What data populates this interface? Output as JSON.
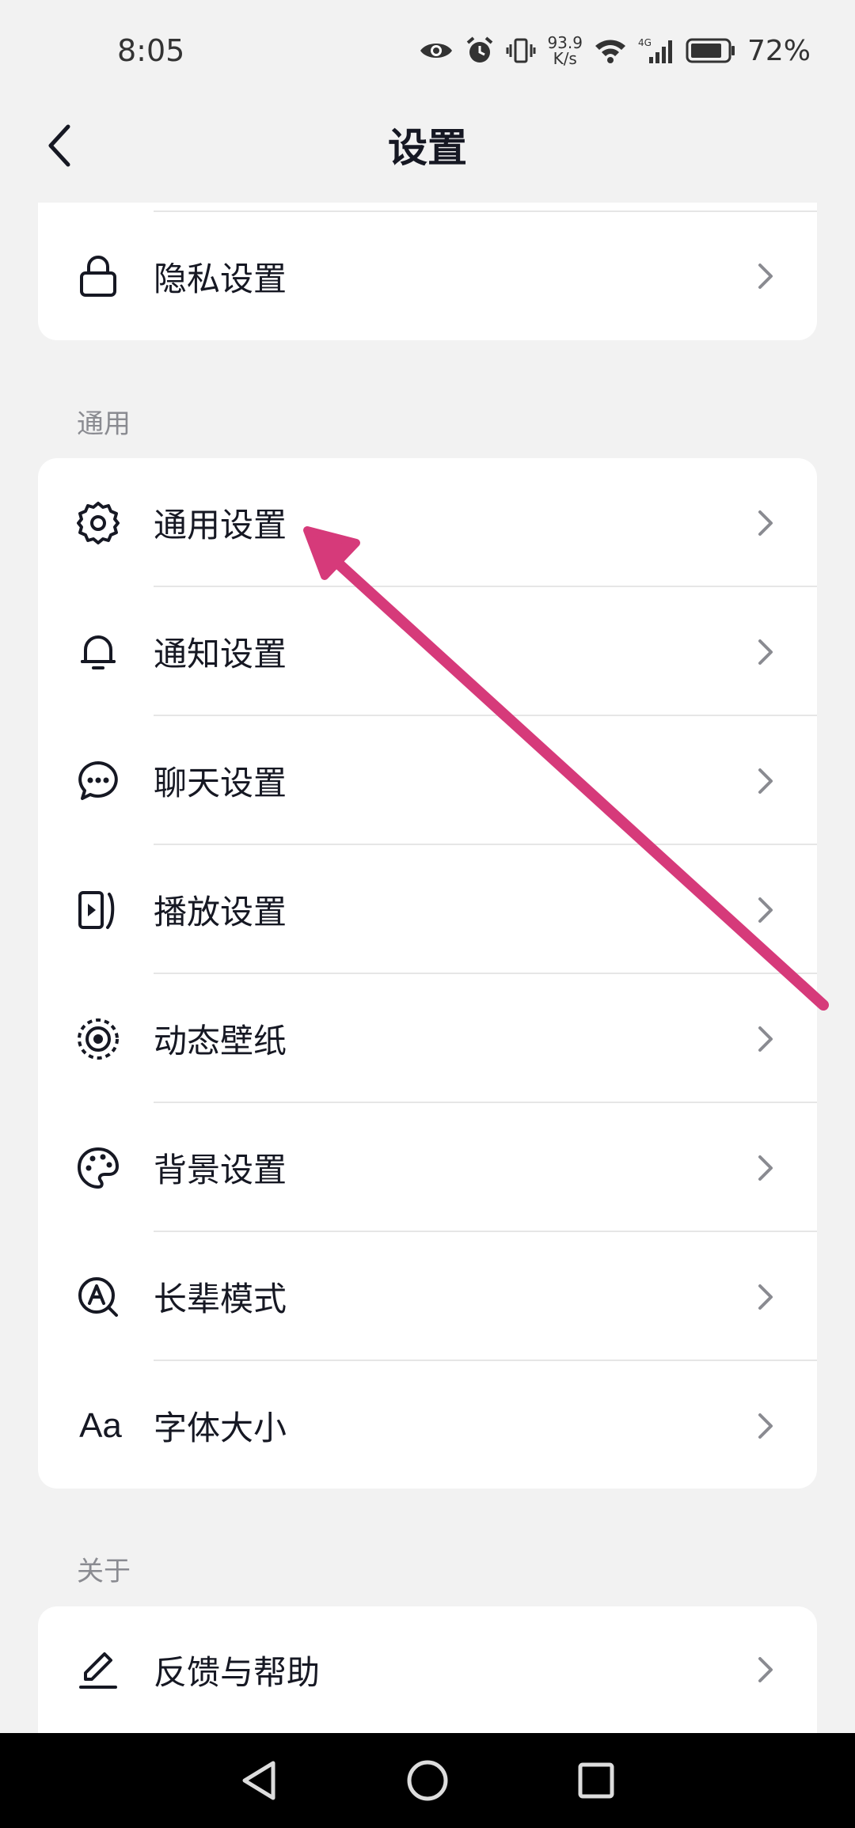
{
  "status_bar": {
    "time": "8:05",
    "net_speed_value": "93.9",
    "net_speed_unit": "K/s",
    "network_type": "4G",
    "battery": "72%"
  },
  "header": {
    "title": "设置",
    "back_icon": "back-arrow-icon"
  },
  "top_card": {
    "items": [
      {
        "label": "隐私设置",
        "icon": "lock-icon"
      }
    ]
  },
  "general_section": {
    "title": "通用",
    "items": [
      {
        "label": "通用设置",
        "icon": "gear-icon"
      },
      {
        "label": "通知设置",
        "icon": "bell-icon"
      },
      {
        "label": "聊天设置",
        "icon": "chat-bubble-icon"
      },
      {
        "label": "播放设置",
        "icon": "play-icon"
      },
      {
        "label": "动态壁纸",
        "icon": "live-wallpaper-icon"
      },
      {
        "label": "背景设置",
        "icon": "palette-icon"
      },
      {
        "label": "长辈模式",
        "icon": "elder-mode-icon"
      },
      {
        "label": "字体大小",
        "icon": "font-size-icon",
        "icon_text": "Aa"
      }
    ]
  },
  "about_section": {
    "title": "关于",
    "items": [
      {
        "label": "反馈与帮助",
        "icon": "pen-icon"
      }
    ]
  },
  "annotation": {
    "type": "arrow",
    "color": "#d63a7a",
    "points_to": "通用设置"
  },
  "colors": {
    "background": "#f2f2f2",
    "card": "#ffffff",
    "text": "#161823",
    "section_label": "#8a8b91",
    "chevron": "#8a8b91"
  }
}
